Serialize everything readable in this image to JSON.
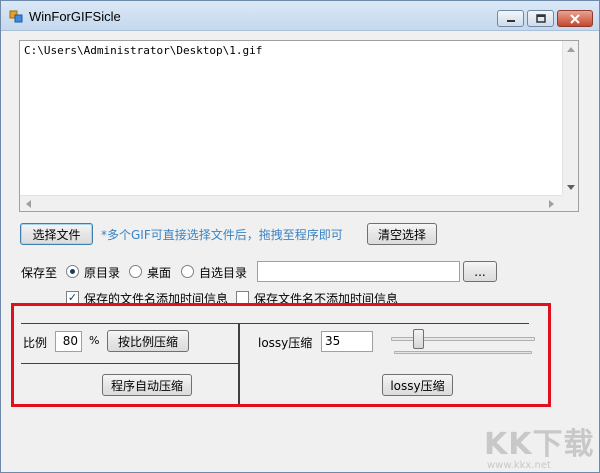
{
  "window": {
    "title": "WinForGIFSicle"
  },
  "file_list": {
    "path": "C:\\Users\\Administrator\\Desktop\\1.gif"
  },
  "toolbar": {
    "choose_file_label": "选择文件",
    "hint": "*多个GIF可直接选择文件后，拖拽至程序即可",
    "clear_label": "清空选择"
  },
  "save": {
    "label": "保存至",
    "options": [
      "原目录",
      "桌面",
      "自选目录"
    ],
    "selected": "原目录",
    "custom_path": "",
    "browse_label": "..."
  },
  "name_options": {
    "add_time": {
      "label": "保存的文件名添加时间信息",
      "checked": true
    },
    "no_time": {
      "label": "保存文件名不添加时间信息",
      "checked": false
    }
  },
  "ratio": {
    "label": "比例",
    "value": "80",
    "unit": "%",
    "button": "按比例压缩",
    "auto_button": "程序自动压缩"
  },
  "lossy": {
    "label": "lossy压缩",
    "value": "35",
    "slider_level": 0.15,
    "button": "lossy压缩"
  },
  "watermark": {
    "logo": "KK下载",
    "url": "www.kkx.net"
  },
  "colors": {
    "highlight": "#e0101d",
    "hint": "#3a83c4"
  }
}
